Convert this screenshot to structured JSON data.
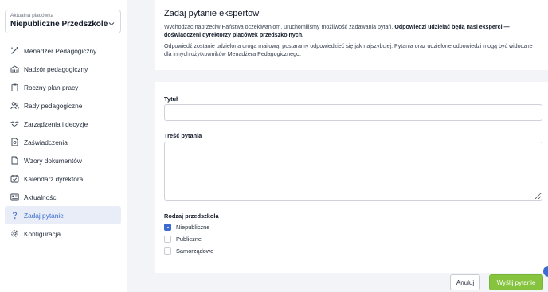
{
  "sidebar": {
    "facility": {
      "label": "Aktualna placówka",
      "value": "Niepubliczne Przedszkole..."
    },
    "items": [
      {
        "label": "Menadżer Pedagogiczny",
        "icon": "wand-icon",
        "active": false
      },
      {
        "label": "Nadzór pedagogiczny",
        "icon": "building-icon",
        "active": false
      },
      {
        "label": "Roczny plan pracy",
        "icon": "clipboard-icon",
        "active": false
      },
      {
        "label": "Rady pedagogiczne",
        "icon": "people-icon",
        "active": false
      },
      {
        "label": "Zarządzenia i decyzje",
        "icon": "handshake-icon",
        "active": false
      },
      {
        "label": "Zaświadczenia",
        "icon": "certificate-icon",
        "active": false
      },
      {
        "label": "Wzory dokumentów",
        "icon": "document-icon",
        "active": false
      },
      {
        "label": "Kalendarz dyrektora",
        "icon": "calendar-check-icon",
        "active": false
      },
      {
        "label": "Aktualności",
        "icon": "news-icon",
        "active": false
      },
      {
        "label": "Zadaj pytanie",
        "icon": "question-icon",
        "active": true
      },
      {
        "label": "Konfiguracja",
        "icon": "gear-icon",
        "active": false
      }
    ]
  },
  "intro": {
    "title": "Zadaj pytanie ekspertowi",
    "p1_normal": "Wychodząc naprzeciw Państwa oczekiwaniom, uruchomiliśmy możliwość zadawania pytań. ",
    "p1_bold": "Odpowiedzi udzielać będą nasi eksperci — doświadczeni dyrektorzy placówek przedszkolnych.",
    "p2": "Odpowiedź zostanie udzielona drogą mailową, postaramy odpowiedzieć się jak najszybciej. Pytania oraz udzielone odpowiedzi mogą być widoczne dla innych użytkowników Menadżera Pedagogicznego."
  },
  "form": {
    "title_label": "Tytuł",
    "title_value": "",
    "content_label": "Treść pytania",
    "content_value": "",
    "type_label": "Rodzaj przedszkola",
    "options": [
      {
        "label": "Niepubliczne",
        "selected": true
      },
      {
        "label": "Publiczne",
        "selected": false
      },
      {
        "label": "Samorządowe",
        "selected": false
      }
    ]
  },
  "actions": {
    "cancel_label": "Anuluj",
    "submit_label": "Wyślij pytanie"
  },
  "colors": {
    "accent": "#3b6ad0",
    "submit": "#86c440",
    "active_bg": "#e8edf7"
  }
}
